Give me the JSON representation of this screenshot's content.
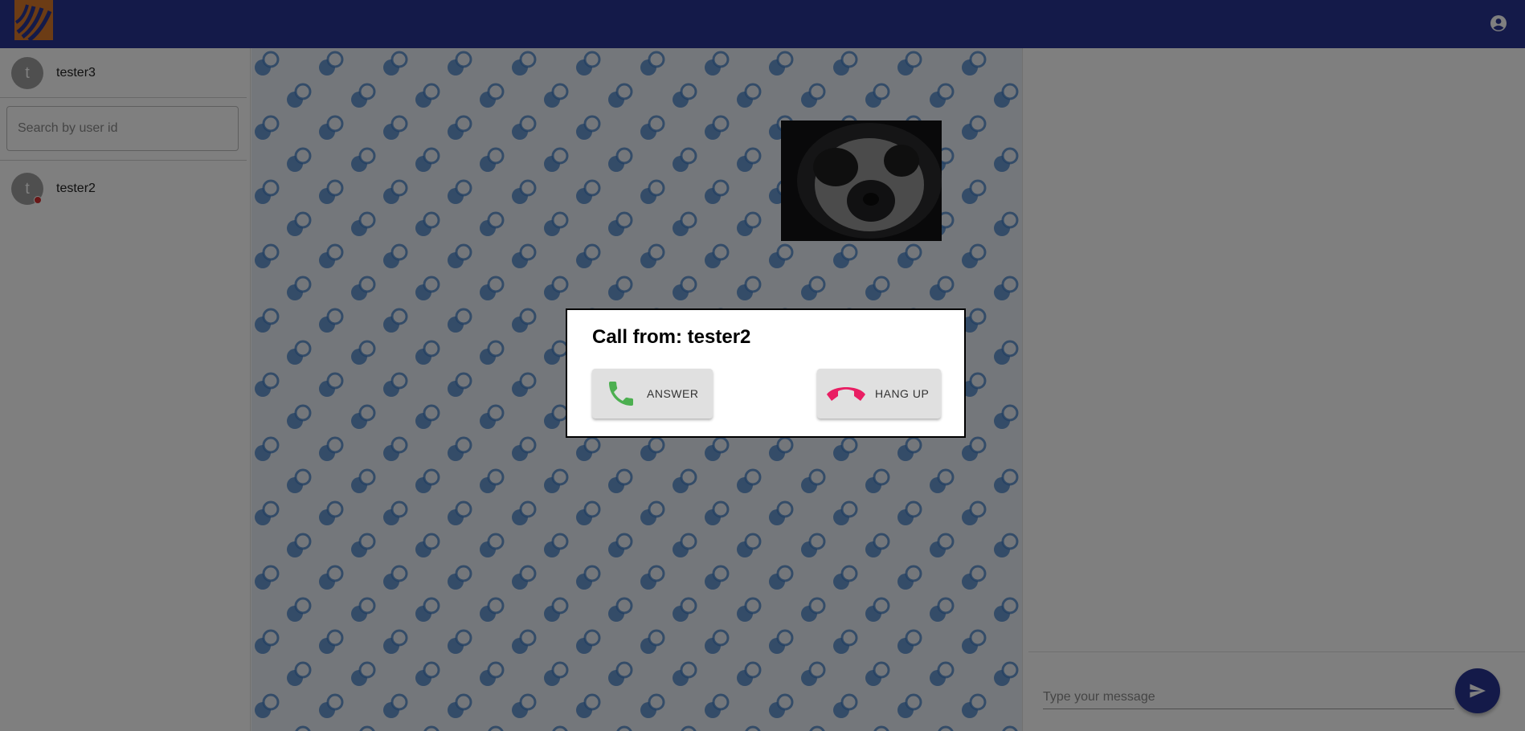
{
  "header": {
    "logo": "app-logo",
    "account_icon": "account-circle-icon",
    "colors": {
      "bar": "#283593"
    }
  },
  "sidebar": {
    "current_user": {
      "initial": "t",
      "name": "tester3"
    },
    "search": {
      "placeholder": "Search by user id",
      "value": ""
    },
    "contacts": [
      {
        "initial": "t",
        "name": "tester2",
        "status_color": "#d32f2f"
      }
    ]
  },
  "chat": {
    "pattern_color": "#2a66b0",
    "video": "remote-video-preview"
  },
  "composer": {
    "placeholder": "Type your message",
    "value": "",
    "send_icon": "send-icon"
  },
  "call_dialog": {
    "title": "Call from: tester2",
    "answer_label": "ANSWER",
    "hangup_label": "HANG UP",
    "answer_icon": "phone-icon",
    "hangup_icon": "call-end-icon",
    "colors": {
      "answer": "#4caf50",
      "hangup": "#e91e63"
    }
  }
}
